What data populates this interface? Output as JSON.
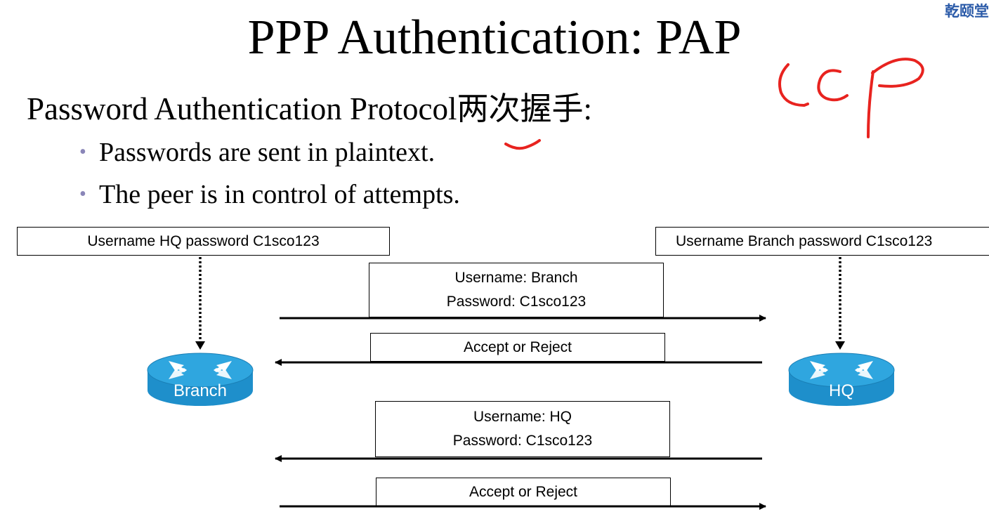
{
  "slide": {
    "title": "PPP Authentication: PAP",
    "watermark": "乾颐堂",
    "subtitle": "Password Authentication Protocol两次握手:",
    "bullets": [
      "Passwords are sent in plaintext.",
      "The peer is in control of attempts."
    ],
    "handwriting": "LCP"
  },
  "diagram": {
    "left_config": "Username HQ password C1sco123",
    "right_config": "Username Branch password C1sco123",
    "left_router": "Branch",
    "right_router": "HQ",
    "messages": [
      {
        "line1": "Username: Branch",
        "line2": "Password: C1sco123",
        "direction": "right"
      },
      {
        "line1": "Accept or Reject",
        "direction": "left"
      },
      {
        "line1": "Username: HQ",
        "line2": "Password: C1sco123",
        "direction": "left"
      },
      {
        "line1": "Accept or Reject",
        "direction": "right"
      }
    ],
    "colors": {
      "router": "#1e8fcb",
      "router_top": "#2fa6df",
      "handwriting": "#e8231f",
      "bullet": "#8a86b8"
    }
  }
}
